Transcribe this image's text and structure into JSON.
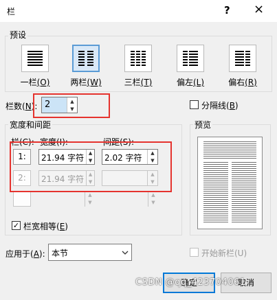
{
  "window": {
    "title": "栏",
    "help_icon": "?",
    "close_icon": "×"
  },
  "presets": {
    "group_label": "预设",
    "items": [
      {
        "label": "一栏",
        "key": "(O)",
        "icon": "one-column-icon",
        "selected": false
      },
      {
        "label": "两栏",
        "key": "(W)",
        "icon": "two-columns-icon",
        "selected": true
      },
      {
        "label": "三栏",
        "key": "(T)",
        "icon": "three-columns-icon",
        "selected": false
      },
      {
        "label": "偏左",
        "key": "(L)",
        "icon": "left-column-icon",
        "selected": false
      },
      {
        "label": "偏右",
        "key": "(R)",
        "icon": "right-column-icon",
        "selected": false
      }
    ]
  },
  "columns_count": {
    "label": "栏数(",
    "key": "N",
    "label_end": "):",
    "value": "2"
  },
  "line_between": {
    "label": "分隔线(",
    "key": "B",
    "label_end": ")",
    "checked": false
  },
  "width_spacing": {
    "group_label": "宽度和间距",
    "col_header": "栏(C):",
    "width_header": "宽度(I):",
    "spacing_header": "间距(S):",
    "rows": [
      {
        "col": "1:",
        "width": "21.94 字符",
        "spacing": "2.02 字符",
        "enabled": true
      },
      {
        "col": "2:",
        "width": "21.94 字符",
        "spacing": "",
        "enabled": false
      },
      {
        "col": "",
        "width": "",
        "spacing": "",
        "enabled": false
      }
    ]
  },
  "equal_width": {
    "label": "栏宽相等(",
    "key": "E",
    "label_end": ")",
    "checked": true
  },
  "preview": {
    "group_label": "预览"
  },
  "apply_to": {
    "label": "应用于(",
    "key": "A",
    "label_end": "):",
    "value": "本节",
    "chevron_icon": "chevron-down-icon"
  },
  "start_new_column": {
    "label": "开始新栏(U)",
    "checked": false,
    "enabled": false
  },
  "buttons": {
    "ok": "确定",
    "cancel": "取消"
  },
  "watermark": "CSDN @qq_423704061",
  "colors": {
    "highlight_red": "#e5322d",
    "selected_blue": "#5a9bd5",
    "default_button_border": "#0078d7"
  }
}
